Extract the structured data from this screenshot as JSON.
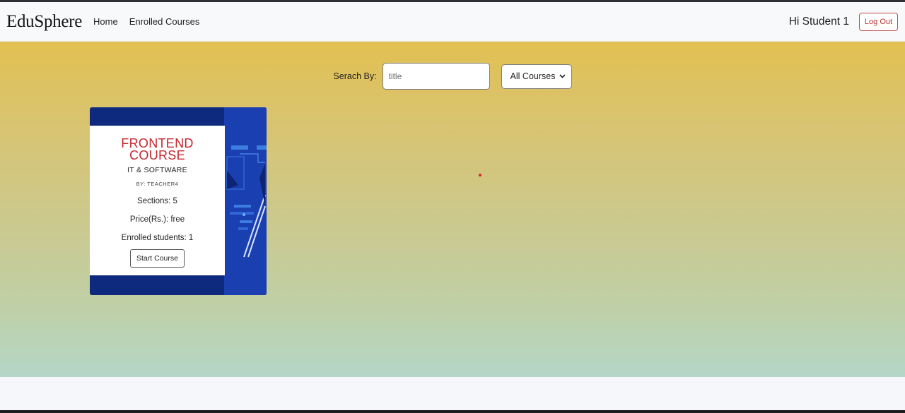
{
  "navbar": {
    "brand": "EduSphere",
    "links": [
      "Home",
      "Enrolled Courses"
    ],
    "greeting": "Hi Student 1",
    "logout_label": "Log Out"
  },
  "search": {
    "label": "Serach By:",
    "placeholder": "title",
    "filter_selected": "All Courses"
  },
  "courses": [
    {
      "title_line1": "FRONTEND",
      "title_line2": "COURSE",
      "category": "IT & SOFTWARE",
      "author": "BY: TEACHER4",
      "sections": "Sections: 5",
      "price": "Price(Rs.): free",
      "enrolled": "Enrolled students: 1",
      "button": "Start Course"
    }
  ],
  "icons": {
    "select_arrow": "chevron-down-icon"
  },
  "colors": {
    "title_red": "#c4262e",
    "card_navy": "#0e2a7e",
    "logout_red": "#b93232"
  }
}
